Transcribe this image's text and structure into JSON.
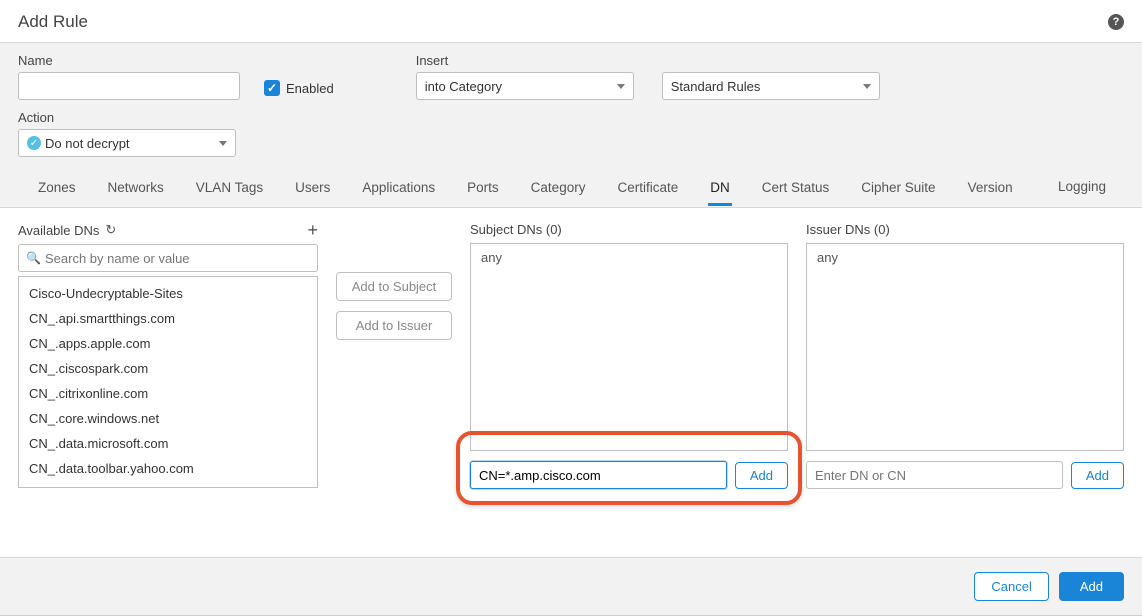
{
  "header": {
    "title": "Add Rule"
  },
  "form": {
    "name_label": "Name",
    "name_value": "",
    "enabled_label": "Enabled",
    "enabled_checked": true,
    "insert_label": "Insert",
    "insert_value": "into Category",
    "standard_value": "Standard Rules",
    "action_label": "Action",
    "action_value": "Do not decrypt"
  },
  "tabs": {
    "items": [
      "Zones",
      "Networks",
      "VLAN Tags",
      "Users",
      "Applications",
      "Ports",
      "Category",
      "Certificate",
      "DN",
      "Cert Status",
      "Cipher Suite",
      "Version"
    ],
    "active": "DN",
    "right": "Logging"
  },
  "available": {
    "label": "Available DNs",
    "search_placeholder": "Search by name or value",
    "items": [
      "Cisco-Undecryptable-Sites",
      "CN_.api.smartthings.com",
      "CN_.apps.apple.com",
      "CN_.ciscospark.com",
      "CN_.citrixonline.com",
      "CN_.core.windows.net",
      "CN_.data.microsoft.com",
      "CN_.data.toolbar.yahoo.com"
    ]
  },
  "buttons": {
    "add_subject": "Add to Subject",
    "add_issuer": "Add to Issuer"
  },
  "subject": {
    "label": "Subject DNs (0)",
    "placeholder_value": "any",
    "input_value": "CN=*.amp.cisco.com",
    "add_label": "Add"
  },
  "issuer": {
    "label": "Issuer DNs (0)",
    "placeholder_value": "any",
    "input_placeholder": "Enter DN or CN",
    "add_label": "Add"
  },
  "footer": {
    "cancel": "Cancel",
    "add": "Add"
  }
}
